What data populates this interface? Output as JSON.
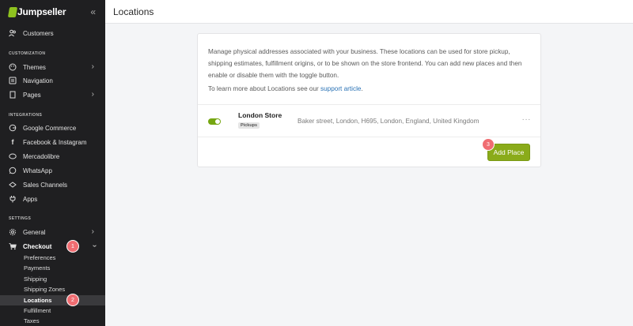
{
  "brand": {
    "logo": "Jumpseller",
    "collapse_icon": "«"
  },
  "header": {
    "title": "Locations"
  },
  "sidebar": {
    "customers": "Customers",
    "sections": {
      "customization": "CUSTOMIZATION",
      "integrations": "INTEGRATIONS",
      "settings": "SETTINGS"
    },
    "customization_items": [
      "Themes",
      "Navigation",
      "Pages"
    ],
    "integration_items": [
      "Google Commerce",
      "Facebook & Instagram",
      "Mercadolibre",
      "WhatsApp",
      "Sales Channels",
      "Apps"
    ],
    "settings_items": [
      "General",
      "Checkout"
    ],
    "checkout_sub": [
      "Preferences",
      "Payments",
      "Shipping",
      "Shipping Zones",
      "Locations",
      "Fulfillment",
      "Taxes"
    ],
    "badges": [
      "1",
      "2"
    ]
  },
  "main": {
    "description": "Manage physical addresses associated with your business. These locations can be used for store pickup, shipping estimates, fulfillment origins, or to be shown on the store frontend. You can add new places and then enable or disable them with the toggle button.",
    "learn_prefix": "To learn more about Locations see our",
    "learn_link": "support article",
    "learn_suffix": ".",
    "location": {
      "name": "London Store",
      "tag": "Pickups",
      "address": "Baker street, London, H695, London, England, United Kingdom",
      "enabled": true,
      "more": "···"
    },
    "add_button": "Add Place",
    "add_badge": "3"
  },
  "colors": {
    "sidebar_bg": "#1f1f21",
    "accent_green": "#8aab1a",
    "badge": "#f06d72",
    "link": "#2a72b5"
  }
}
